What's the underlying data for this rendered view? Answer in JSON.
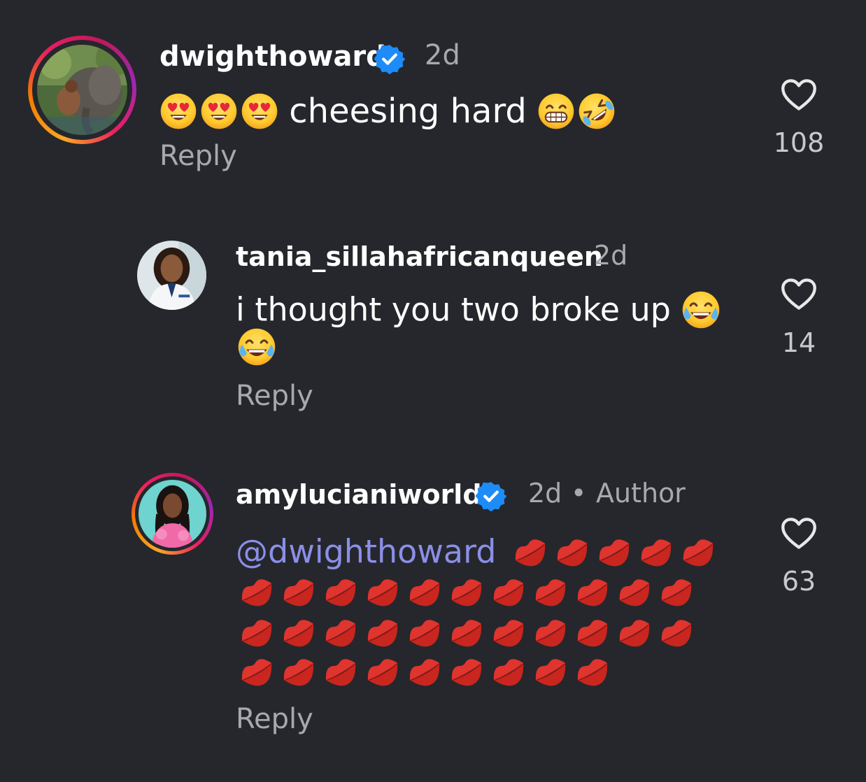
{
  "comments": [
    {
      "username": "dwighthoward",
      "verified": true,
      "time": "2d",
      "text": "cheesing hard",
      "reply_label": "Reply",
      "likes": "108",
      "avatar": "elephant-photo"
    },
    {
      "username": "tania_sillahafricanqueen",
      "verified": false,
      "time": "2d",
      "text": "i thought you two broke up",
      "reply_label": "Reply",
      "likes": "14",
      "avatar": "woman-in-lab-coat-photo"
    },
    {
      "username": "amylucianiworld",
      "verified": true,
      "time": "2d",
      "author_separator": "•",
      "author_label": "Author",
      "mention": "@dwighthoward",
      "reply_label": "Reply",
      "likes": "63",
      "avatar": "woman-in-pink-photo"
    }
  ],
  "colors": {
    "background": "#25272c",
    "verified": "#1d8cf8",
    "mention": "#8b8fe8",
    "muted": "#a7a9ad",
    "kiss": "#e0342f"
  },
  "icons": {
    "like": "heart-outline-icon",
    "verified": "verified-badge-icon",
    "heart_eyes": "smiling-face-with-heart-eyes",
    "grin": "beaming-face",
    "rofl": "rolling-on-floor-laughing",
    "joy": "face-with-tears-of-joy",
    "kiss": "kiss-mark"
  }
}
